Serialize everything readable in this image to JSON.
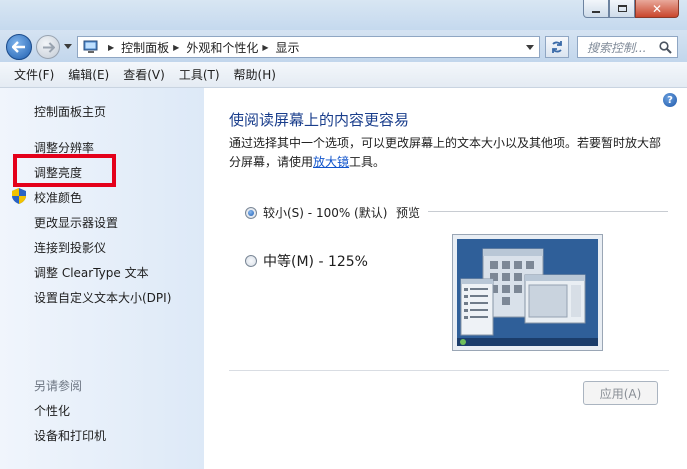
{
  "breadcrumb": [
    {
      "label": "控制面板"
    },
    {
      "label": "外观和个性化"
    },
    {
      "label": "显示"
    }
  ],
  "search": {
    "placeholder": "搜索控制..."
  },
  "menu": [
    "文件(F)",
    "编辑(E)",
    "查看(V)",
    "工具(T)",
    "帮助(H)"
  ],
  "sidebar": {
    "home": "控制面板主页",
    "items": [
      {
        "label": "调整分辨率"
      },
      {
        "label": "调整亮度",
        "highlighted": true
      },
      {
        "label": "校准颜色"
      },
      {
        "label": "更改显示器设置"
      },
      {
        "label": "连接到投影仪"
      },
      {
        "label": "调整 ClearType 文本"
      },
      {
        "label": "设置自定义文本大小(DPI)"
      }
    ],
    "see_also_title": "另请参阅",
    "see_also": [
      {
        "label": "个性化"
      },
      {
        "label": "设备和打印机"
      }
    ]
  },
  "main": {
    "title": "使阅读屏幕上的内容更容易",
    "desc_line1": "通过选择其中一个选项，可以更改屏幕上的文本大小以及其他项。若要暂时放大部",
    "desc_line2_before": "分屏幕，请使用",
    "desc_link": "放大镜",
    "desc_line2_after": "工具。",
    "options": [
      {
        "label": "较小(S) - 100% (默认)",
        "selected": true
      },
      {
        "label": "中等(M) - 125%",
        "selected": false
      }
    ],
    "preview_label": "预览",
    "apply_label": "应用(A)"
  },
  "colors": {
    "highlight_box": "#e4001a",
    "title": "#1a3e8c",
    "link": "#1155cc"
  }
}
